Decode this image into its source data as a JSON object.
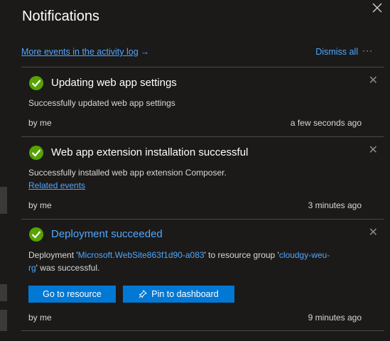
{
  "panel": {
    "title": "Notifications",
    "activity_link": "More events in the activity log",
    "activity_arrow": "→",
    "dismiss_all": "Dismiss all",
    "more": "···"
  },
  "notifications": [
    {
      "title": "Updating web app settings",
      "message": "Successfully updated web app settings",
      "by": "by me",
      "time": "a few seconds ago"
    },
    {
      "title": "Web app extension installation successful",
      "message": "Successfully installed web app extension Composer.",
      "link": "Related events",
      "by": "by me",
      "time": "3 minutes ago"
    },
    {
      "title": "Deployment succeeded",
      "message_pre": "Deployment '",
      "deployment_name": "Microsoft.WebSite863f1d90-a083",
      "message_mid": "' to resource group '",
      "resource_group": "cloudgy-weu-rg",
      "message_post": "' was successful.",
      "button_go": "Go to resource",
      "button_pin": "Pin to dashboard",
      "by": "by me",
      "time": "9 minutes ago"
    }
  ],
  "colors": {
    "accent": "#0078d4",
    "link": "#4fa7ff",
    "success": "#57a300",
    "background": "#1b1a19"
  }
}
